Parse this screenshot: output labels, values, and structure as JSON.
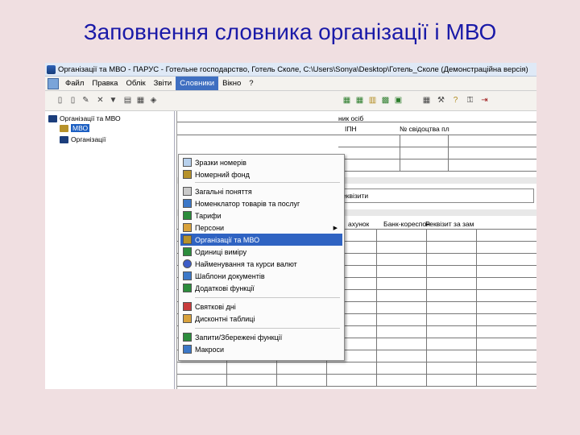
{
  "slide": {
    "title": "Заповнення словника організації і МВО"
  },
  "window": {
    "title": "Організації та МВО - ПАРУС - Готельне господарство, Готель Сколе, C:\\Users\\Sonya\\Desktop\\Готель_Сколе (Демонстраційна версія)"
  },
  "menu": {
    "items": [
      "Файл",
      "Правка",
      "Облік",
      "Звіти",
      "Словники",
      "Вікно",
      "?"
    ]
  },
  "tree": {
    "root": "Організації та МВО",
    "mvo": "МВО",
    "orgs": "Організації"
  },
  "panel": {
    "header_fragment": "ник осіб",
    "col_ipn": "ІПН",
    "col_cert": "№ свідоцтва пл",
    "requisites": "еквізити",
    "col_account": "ахунок",
    "col_bank": "Банк-кореспон",
    "col_requisite": "Реквізит за зам"
  },
  "dropdown": {
    "items": [
      "Зразки номерів",
      "Номерний фонд",
      "Загальні поняття",
      "Номенклатор товарів та послуг",
      "Тарифи",
      "Персони",
      "Організації та МВО",
      "Одиниці виміру",
      "Найменування та курси валют",
      "Шаблони документів",
      "Додаткові функції",
      "Святкові дні",
      "Дисконтні таблиці",
      "Запити/Збережені функції",
      "Макроси"
    ]
  }
}
